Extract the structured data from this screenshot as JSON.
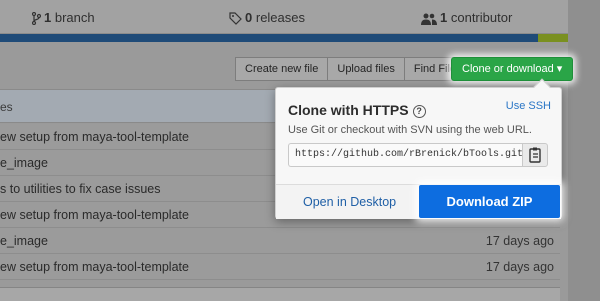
{
  "stats": {
    "branches": {
      "count": "1",
      "label": "branch"
    },
    "releases": {
      "count": "0",
      "label": "releases"
    },
    "contributors": {
      "count": "1",
      "label": "contributor"
    }
  },
  "toolbar": {
    "create_new_file": "Create new file",
    "upload_files": "Upload files",
    "find_file": "Find File",
    "clone_or_download": "Clone or download ▾"
  },
  "table": {
    "header_text": "es",
    "rows": [
      {
        "message": "ew setup from maya-tool-template",
        "age": ""
      },
      {
        "message": "e_image",
        "age": ""
      },
      {
        "message": "s to utilities to fix case issues",
        "age": ""
      },
      {
        "message": "ew setup from maya-tool-template",
        "age": ""
      },
      {
        "message": "e_image",
        "age": "17 days ago"
      },
      {
        "message": "ew setup from maya-tool-template",
        "age": "17 days ago"
      }
    ]
  },
  "clone_panel": {
    "title": "Clone with HTTPS",
    "help_glyph": "?",
    "use_ssh": "Use SSH",
    "description": "Use Git or checkout with SVN using the web URL.",
    "url": "https://github.com/rBrenick/bTools.git",
    "open_in_desktop": "Open in Desktop",
    "download_zip": "Download ZIP"
  },
  "colors": {
    "clone_button": "#2aa547",
    "download_zip": "#0d6de0",
    "link": "#2a76c6"
  }
}
